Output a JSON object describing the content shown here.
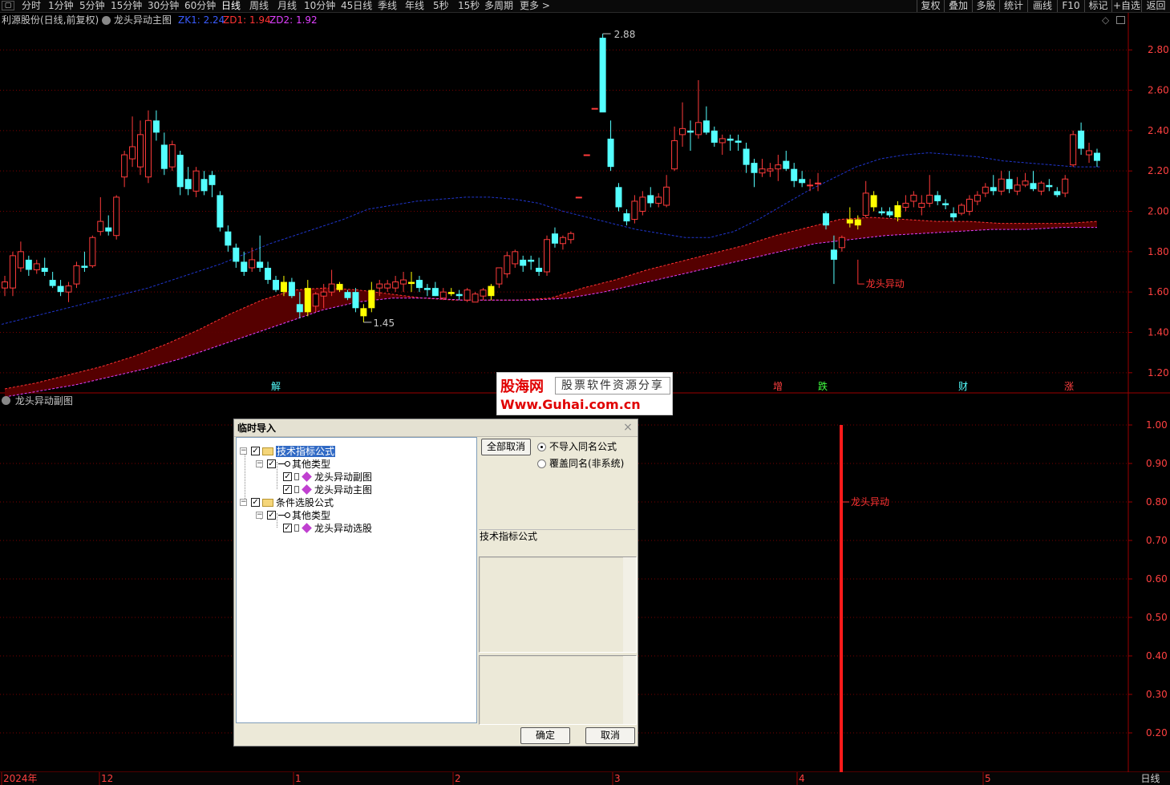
{
  "toolbar": {
    "periods": [
      "分时",
      "1分钟",
      "5分钟",
      "15分钟",
      "30分钟",
      "60分钟",
      "日线",
      "周线",
      "月线",
      "10分钟",
      "45日线",
      "季线",
      "年线",
      "5秒",
      "15秒",
      "多周期",
      "更多 >"
    ],
    "active_period": "日线",
    "right_buttons": [
      "复权",
      "叠加",
      "多股",
      "统计",
      "画线",
      "F10",
      "标记",
      "+自选",
      "返回"
    ]
  },
  "main_title": {
    "stock": "利源股份(日线,前复权)",
    "indicator": "龙头异动主图",
    "zk1_label": "ZK1: 2.24",
    "zd1_label": "ZD1: 1.94",
    "zd2_label": "ZD2: 1.92"
  },
  "sub_title": "龙头异动副图",
  "colors": {
    "up": "#ff3b3b",
    "down": "#54ffff",
    "signal": "#ffff00",
    "band": "#5a0000",
    "ma": "#2036d0",
    "zk1": "#3a5cff",
    "zd1": "#ff3333",
    "zd2": "#e040ff",
    "grid": "#7a0000"
  },
  "chart_data": [
    {
      "type": "candlestick",
      "title": "龙头异动主图",
      "ylim": [
        1.1,
        2.92
      ],
      "y_ticks": [
        "2.80",
        "2.60",
        "2.40",
        "2.20",
        "2.00",
        "1.80",
        "1.60",
        "1.40",
        "1.20"
      ],
      "x_labels": [
        "2024年",
        "12",
        "1",
        "2",
        "3",
        "4",
        "5"
      ],
      "candles": [
        {
          "o": 1.62,
          "h": 1.68,
          "l": 1.58,
          "c": 1.65
        },
        {
          "o": 1.62,
          "h": 1.8,
          "l": 1.58,
          "c": 1.78
        },
        {
          "o": 1.72,
          "h": 1.85,
          "l": 1.7,
          "c": 1.8
        },
        {
          "o": 1.76,
          "h": 1.78,
          "l": 1.68,
          "c": 1.71
        },
        {
          "o": 1.71,
          "h": 1.76,
          "l": 1.69,
          "c": 1.74
        },
        {
          "o": 1.72,
          "h": 1.77,
          "l": 1.68,
          "c": 1.7
        },
        {
          "o": 1.66,
          "h": 1.7,
          "l": 1.62,
          "c": 1.63
        },
        {
          "o": 1.63,
          "h": 1.66,
          "l": 1.58,
          "c": 1.6
        },
        {
          "o": 1.6,
          "h": 1.65,
          "l": 1.55,
          "c": 1.63
        },
        {
          "o": 1.64,
          "h": 1.75,
          "l": 1.62,
          "c": 1.73
        },
        {
          "o": 1.73,
          "h": 1.8,
          "l": 1.7,
          "c": 1.72
        },
        {
          "o": 1.73,
          "h": 1.88,
          "l": 1.72,
          "c": 1.87
        },
        {
          "o": 1.9,
          "h": 2.07,
          "l": 1.88,
          "c": 1.95
        },
        {
          "o": 1.92,
          "h": 1.98,
          "l": 1.88,
          "c": 1.9
        },
        {
          "o": 1.88,
          "h": 2.08,
          "l": 1.86,
          "c": 2.07
        },
        {
          "o": 2.17,
          "h": 2.3,
          "l": 2.12,
          "c": 2.28
        },
        {
          "o": 2.26,
          "h": 2.47,
          "l": 2.22,
          "c": 2.32
        },
        {
          "o": 2.22,
          "h": 2.45,
          "l": 2.18,
          "c": 2.38
        },
        {
          "o": 2.17,
          "h": 2.5,
          "l": 2.14,
          "c": 2.45
        },
        {
          "o": 2.45,
          "h": 2.5,
          "l": 2.35,
          "c": 2.39
        },
        {
          "o": 2.33,
          "h": 2.39,
          "l": 2.18,
          "c": 2.21
        },
        {
          "o": 2.22,
          "h": 2.35,
          "l": 2.2,
          "c": 2.33
        },
        {
          "o": 2.28,
          "h": 2.3,
          "l": 2.08,
          "c": 2.12
        },
        {
          "o": 2.16,
          "h": 2.22,
          "l": 2.08,
          "c": 2.11
        },
        {
          "o": 2.1,
          "h": 2.22,
          "l": 2.07,
          "c": 2.2
        },
        {
          "o": 2.16,
          "h": 2.2,
          "l": 2.08,
          "c": 2.1
        },
        {
          "o": 2.18,
          "h": 2.2,
          "l": 2.07,
          "c": 2.13
        },
        {
          "o": 2.08,
          "h": 2.1,
          "l": 1.9,
          "c": 1.92
        },
        {
          "o": 1.9,
          "h": 1.93,
          "l": 1.8,
          "c": 1.83
        },
        {
          "o": 1.82,
          "h": 1.84,
          "l": 1.72,
          "c": 1.75
        },
        {
          "o": 1.75,
          "h": 1.8,
          "l": 1.68,
          "c": 1.7
        },
        {
          "o": 1.72,
          "h": 1.82,
          "l": 1.7,
          "c": 1.76
        },
        {
          "o": 1.75,
          "h": 1.88,
          "l": 1.7,
          "c": 1.72
        },
        {
          "o": 1.72,
          "h": 1.75,
          "l": 1.64,
          "c": 1.66
        },
        {
          "o": 1.66,
          "h": 1.68,
          "l": 1.6,
          "c": 1.61
        },
        {
          "o": 1.6,
          "h": 1.68,
          "l": 1.58,
          "c": 1.65
        },
        {
          "o": 1.65,
          "h": 1.67,
          "l": 1.57,
          "c": 1.58
        },
        {
          "o": 1.54,
          "h": 1.6,
          "l": 1.47,
          "c": 1.5
        },
        {
          "o": 1.5,
          "h": 1.66,
          "l": 1.48,
          "c": 1.62
        },
        {
          "o": 1.53,
          "h": 1.6,
          "l": 1.5,
          "c": 1.59
        },
        {
          "o": 1.58,
          "h": 1.64,
          "l": 1.52,
          "c": 1.6
        },
        {
          "o": 1.6,
          "h": 1.71,
          "l": 1.58,
          "c": 1.64
        },
        {
          "o": 1.64,
          "h": 1.65,
          "l": 1.6,
          "c": 1.61
        },
        {
          "o": 1.6,
          "h": 1.61,
          "l": 1.56,
          "c": 1.57
        },
        {
          "o": 1.6,
          "h": 1.62,
          "l": 1.5,
          "c": 1.52
        },
        {
          "o": 1.52,
          "h": 1.54,
          "l": 1.45,
          "c": 1.48
        },
        {
          "o": 1.52,
          "h": 1.65,
          "l": 1.5,
          "c": 1.61
        },
        {
          "o": 1.62,
          "h": 1.66,
          "l": 1.58,
          "c": 1.64
        },
        {
          "o": 1.62,
          "h": 1.66,
          "l": 1.6,
          "c": 1.64
        },
        {
          "o": 1.62,
          "h": 1.68,
          "l": 1.6,
          "c": 1.65
        },
        {
          "o": 1.64,
          "h": 1.7,
          "l": 1.6,
          "c": 1.66
        },
        {
          "o": 1.64,
          "h": 1.7,
          "l": 1.6,
          "c": 1.65
        },
        {
          "o": 1.66,
          "h": 1.68,
          "l": 1.6,
          "c": 1.62
        },
        {
          "o": 1.62,
          "h": 1.64,
          "l": 1.58,
          "c": 1.61
        },
        {
          "o": 1.62,
          "h": 1.65,
          "l": 1.58,
          "c": 1.58
        },
        {
          "o": 1.57,
          "h": 1.62,
          "l": 1.56,
          "c": 1.6
        },
        {
          "o": 1.6,
          "h": 1.62,
          "l": 1.58,
          "c": 1.59
        },
        {
          "o": 1.59,
          "h": 1.61,
          "l": 1.56,
          "c": 1.58
        },
        {
          "o": 1.56,
          "h": 1.62,
          "l": 1.55,
          "c": 1.61
        },
        {
          "o": 1.55,
          "h": 1.6,
          "l": 1.55,
          "c": 1.59
        },
        {
          "o": 1.58,
          "h": 1.62,
          "l": 1.56,
          "c": 1.61
        },
        {
          "o": 1.58,
          "h": 1.64,
          "l": 1.56,
          "c": 1.63
        },
        {
          "o": 1.64,
          "h": 1.72,
          "l": 1.62,
          "c": 1.72
        },
        {
          "o": 1.69,
          "h": 1.8,
          "l": 1.67,
          "c": 1.78
        },
        {
          "o": 1.74,
          "h": 1.81,
          "l": 1.72,
          "c": 1.8
        },
        {
          "o": 1.76,
          "h": 1.78,
          "l": 1.7,
          "c": 1.73
        },
        {
          "o": 1.76,
          "h": 1.78,
          "l": 1.71,
          "c": 1.75
        },
        {
          "o": 1.72,
          "h": 1.77,
          "l": 1.68,
          "c": 1.7
        },
        {
          "o": 1.7,
          "h": 1.88,
          "l": 1.68,
          "c": 1.86
        },
        {
          "o": 1.89,
          "h": 1.92,
          "l": 1.82,
          "c": 1.84
        },
        {
          "o": 1.84,
          "h": 1.88,
          "l": 1.81,
          "c": 1.87
        },
        {
          "o": 1.86,
          "h": 1.9,
          "l": 1.84,
          "c": 1.89
        },
        {
          "o": 2.07,
          "h": 2.07,
          "l": 2.07,
          "c": 2.07
        },
        {
          "o": 2.28,
          "h": 2.28,
          "l": 2.28,
          "c": 2.28
        },
        {
          "o": 2.51,
          "h": 2.51,
          "l": 2.51,
          "c": 2.51
        },
        {
          "o": 2.86,
          "h": 2.88,
          "l": 2.5,
          "c": 2.49
        },
        {
          "o": 2.36,
          "h": 2.45,
          "l": 2.2,
          "c": 2.22
        },
        {
          "o": 2.12,
          "h": 2.14,
          "l": 2.0,
          "c": 2.02
        },
        {
          "o": 1.99,
          "h": 2.01,
          "l": 1.93,
          "c": 1.95
        },
        {
          "o": 1.96,
          "h": 2.08,
          "l": 1.94,
          "c": 2.05
        },
        {
          "o": 2.0,
          "h": 2.1,
          "l": 1.98,
          "c": 2.07
        },
        {
          "o": 2.08,
          "h": 2.12,
          "l": 2.02,
          "c": 2.04
        },
        {
          "o": 2.04,
          "h": 2.09,
          "l": 2.02,
          "c": 2.07
        },
        {
          "o": 2.03,
          "h": 2.18,
          "l": 2.02,
          "c": 2.12
        },
        {
          "o": 2.21,
          "h": 2.42,
          "l": 2.2,
          "c": 2.35
        },
        {
          "o": 2.38,
          "h": 2.54,
          "l": 2.32,
          "c": 2.41
        },
        {
          "o": 2.4,
          "h": 2.45,
          "l": 2.3,
          "c": 2.39
        },
        {
          "o": 2.38,
          "h": 2.65,
          "l": 2.36,
          "c": 2.44
        },
        {
          "o": 2.45,
          "h": 2.52,
          "l": 2.38,
          "c": 2.39
        },
        {
          "o": 2.4,
          "h": 2.42,
          "l": 2.32,
          "c": 2.34
        },
        {
          "o": 2.34,
          "h": 2.38,
          "l": 2.28,
          "c": 2.36
        },
        {
          "o": 2.36,
          "h": 2.38,
          "l": 2.3,
          "c": 2.35
        },
        {
          "o": 2.35,
          "h": 2.38,
          "l": 2.3,
          "c": 2.34
        },
        {
          "o": 2.31,
          "h": 2.34,
          "l": 2.19,
          "c": 2.23
        },
        {
          "o": 2.24,
          "h": 2.26,
          "l": 2.12,
          "c": 2.19
        },
        {
          "o": 2.19,
          "h": 2.26,
          "l": 2.17,
          "c": 2.21
        },
        {
          "o": 2.2,
          "h": 2.24,
          "l": 2.17,
          "c": 2.21
        },
        {
          "o": 2.21,
          "h": 2.28,
          "l": 2.15,
          "c": 2.23
        },
        {
          "o": 2.25,
          "h": 2.3,
          "l": 2.2,
          "c": 2.21
        },
        {
          "o": 2.21,
          "h": 2.24,
          "l": 2.12,
          "c": 2.15
        },
        {
          "o": 2.16,
          "h": 2.2,
          "l": 2.12,
          "c": 2.14
        },
        {
          "o": 2.13,
          "h": 2.16,
          "l": 2.1,
          "c": 2.13
        },
        {
          "o": 2.14,
          "h": 2.19,
          "l": 2.1,
          "c": 2.14
        },
        {
          "o": 1.99,
          "h": 2.0,
          "l": 1.91,
          "c": 1.93
        },
        {
          "o": 1.81,
          "h": 1.88,
          "l": 1.64,
          "c": 1.76
        },
        {
          "o": 1.82,
          "h": 1.88,
          "l": 1.8,
          "c": 1.87
        },
        {
          "o": 1.96,
          "h": 2.02,
          "l": 1.92,
          "c": 1.94
        },
        {
          "o": 1.96,
          "h": 1.98,
          "l": 1.91,
          "c": 1.93
        },
        {
          "o": 1.98,
          "h": 2.15,
          "l": 1.97,
          "c": 2.09
        },
        {
          "o": 2.08,
          "h": 2.1,
          "l": 2.0,
          "c": 2.02
        },
        {
          "o": 2.0,
          "h": 2.02,
          "l": 1.98,
          "c": 1.99
        },
        {
          "o": 2.0,
          "h": 2.02,
          "l": 1.97,
          "c": 1.98
        },
        {
          "o": 1.97,
          "h": 2.05,
          "l": 1.95,
          "c": 2.03
        },
        {
          "o": 2.02,
          "h": 2.08,
          "l": 2.0,
          "c": 2.04
        },
        {
          "o": 2.05,
          "h": 2.1,
          "l": 2.02,
          "c": 2.08
        },
        {
          "o": 2.02,
          "h": 2.08,
          "l": 1.98,
          "c": 2.04
        },
        {
          "o": 2.04,
          "h": 2.18,
          "l": 2.02,
          "c": 2.08
        },
        {
          "o": 2.08,
          "h": 2.1,
          "l": 2.03,
          "c": 2.05
        },
        {
          "o": 2.04,
          "h": 2.06,
          "l": 2.01,
          "c": 2.03
        },
        {
          "o": 1.99,
          "h": 2.02,
          "l": 1.95,
          "c": 1.97
        },
        {
          "o": 1.99,
          "h": 2.04,
          "l": 1.98,
          "c": 2.03
        },
        {
          "o": 2.0,
          "h": 2.08,
          "l": 1.98,
          "c": 2.06
        },
        {
          "o": 2.05,
          "h": 2.1,
          "l": 2.03,
          "c": 2.08
        },
        {
          "o": 2.09,
          "h": 2.14,
          "l": 2.07,
          "c": 2.12
        },
        {
          "o": 2.12,
          "h": 2.18,
          "l": 2.08,
          "c": 2.1
        },
        {
          "o": 2.1,
          "h": 2.2,
          "l": 2.08,
          "c": 2.16
        },
        {
          "o": 2.16,
          "h": 2.2,
          "l": 2.09,
          "c": 2.11
        },
        {
          "o": 2.1,
          "h": 2.17,
          "l": 2.08,
          "c": 2.13
        },
        {
          "o": 2.13,
          "h": 2.19,
          "l": 2.12,
          "c": 2.15
        },
        {
          "o": 2.14,
          "h": 2.2,
          "l": 2.1,
          "c": 2.11
        },
        {
          "o": 2.1,
          "h": 2.15,
          "l": 2.08,
          "c": 2.14
        },
        {
          "o": 2.13,
          "h": 2.16,
          "l": 2.1,
          "c": 2.12
        },
        {
          "o": 2.1,
          "h": 2.12,
          "l": 2.07,
          "c": 2.08
        },
        {
          "o": 2.09,
          "h": 2.18,
          "l": 2.07,
          "c": 2.16
        },
        {
          "o": 2.23,
          "h": 2.4,
          "l": 2.22,
          "c": 2.38
        },
        {
          "o": 2.4,
          "h": 2.44,
          "l": 2.28,
          "c": 2.31
        },
        {
          "o": 2.28,
          "h": 2.34,
          "l": 2.24,
          "c": 2.3
        },
        {
          "o": 2.29,
          "h": 2.31,
          "l": 2.22,
          "c": 2.25
        }
      ],
      "signal_candles": [
        35,
        38,
        42,
        45,
        46,
        51,
        56,
        61,
        106,
        107,
        109,
        112
      ],
      "ma_line": [
        1.44,
        1.47,
        1.5,
        1.53,
        1.56,
        1.59,
        1.62,
        1.66,
        1.7,
        1.74,
        1.79,
        1.84,
        1.88,
        1.92,
        1.96,
        2.01,
        2.03,
        2.05,
        2.06,
        2.07,
        2.07,
        2.06,
        2.04,
        2.0,
        1.97,
        1.94,
        1.91,
        1.89,
        1.87,
        1.87,
        1.9,
        1.96,
        2.03,
        2.1,
        2.16,
        2.22,
        2.26,
        2.28,
        2.29,
        2.28,
        2.27,
        2.25,
        2.24,
        2.23,
        2.22,
        2.22
      ],
      "band_upper": [
        1.12,
        1.15,
        1.19,
        1.23,
        1.28,
        1.34,
        1.41,
        1.49,
        1.56,
        1.61,
        1.62,
        1.61,
        1.59,
        1.57,
        1.56,
        1.56,
        1.56,
        1.57,
        1.62,
        1.66,
        1.71,
        1.75,
        1.79,
        1.83,
        1.88,
        1.92,
        1.96,
        1.97,
        1.96,
        1.95,
        1.95,
        1.94,
        1.94,
        1.94,
        1.95
      ],
      "band_lower": [
        1.08,
        1.11,
        1.14,
        1.18,
        1.22,
        1.27,
        1.33,
        1.39,
        1.45,
        1.51,
        1.55,
        1.57,
        1.57,
        1.56,
        1.56,
        1.56,
        1.57,
        1.6,
        1.64,
        1.68,
        1.72,
        1.76,
        1.8,
        1.84,
        1.86,
        1.88,
        1.89,
        1.9,
        1.91,
        1.91,
        1.92,
        1.92
      ],
      "annotations": {
        "max": "2.88",
        "min": "1.45",
        "signal": "龙头异动"
      },
      "bottom_labels": [
        "解",
        "增",
        "跌",
        "财",
        "涨"
      ]
    },
    {
      "type": "bar",
      "title": "龙头异动副图",
      "ylim": [
        0.1,
        1.05
      ],
      "y_ticks": [
        "1.00",
        "0.90",
        "0.80",
        "0.70",
        "0.60",
        "0.50",
        "0.40",
        "0.30",
        "0.20"
      ],
      "values": [
        1.0
      ],
      "annotation": "龙头异动"
    }
  ],
  "period_bottom": "日线",
  "logo": {
    "name": "股海网",
    "slogan": "股票软件资源分享",
    "url": "Www.Guhai.com.cn"
  },
  "dialog": {
    "title": "临时导入",
    "close": "×",
    "tree": [
      {
        "label": "技术指标公式",
        "level": 0,
        "kind": "folder"
      },
      {
        "label": "其他类型",
        "level": 1,
        "kind": "key"
      },
      {
        "label": "龙头异动副图",
        "level": 2,
        "kind": "item"
      },
      {
        "label": "龙头异动主图",
        "level": 2,
        "kind": "item"
      },
      {
        "label": "条件选股公式",
        "level": 0,
        "kind": "folder"
      },
      {
        "label": "其他类型",
        "level": 1,
        "kind": "key"
      },
      {
        "label": "龙头异动选股",
        "level": 2,
        "kind": "item"
      }
    ],
    "cancel_all": "全部取消",
    "radio_skip": "不导入同名公式",
    "radio_overwrite": "覆盖同名(非系统)",
    "info_label": "技术指标公式",
    "ok": "确定",
    "cancel": "取消"
  }
}
